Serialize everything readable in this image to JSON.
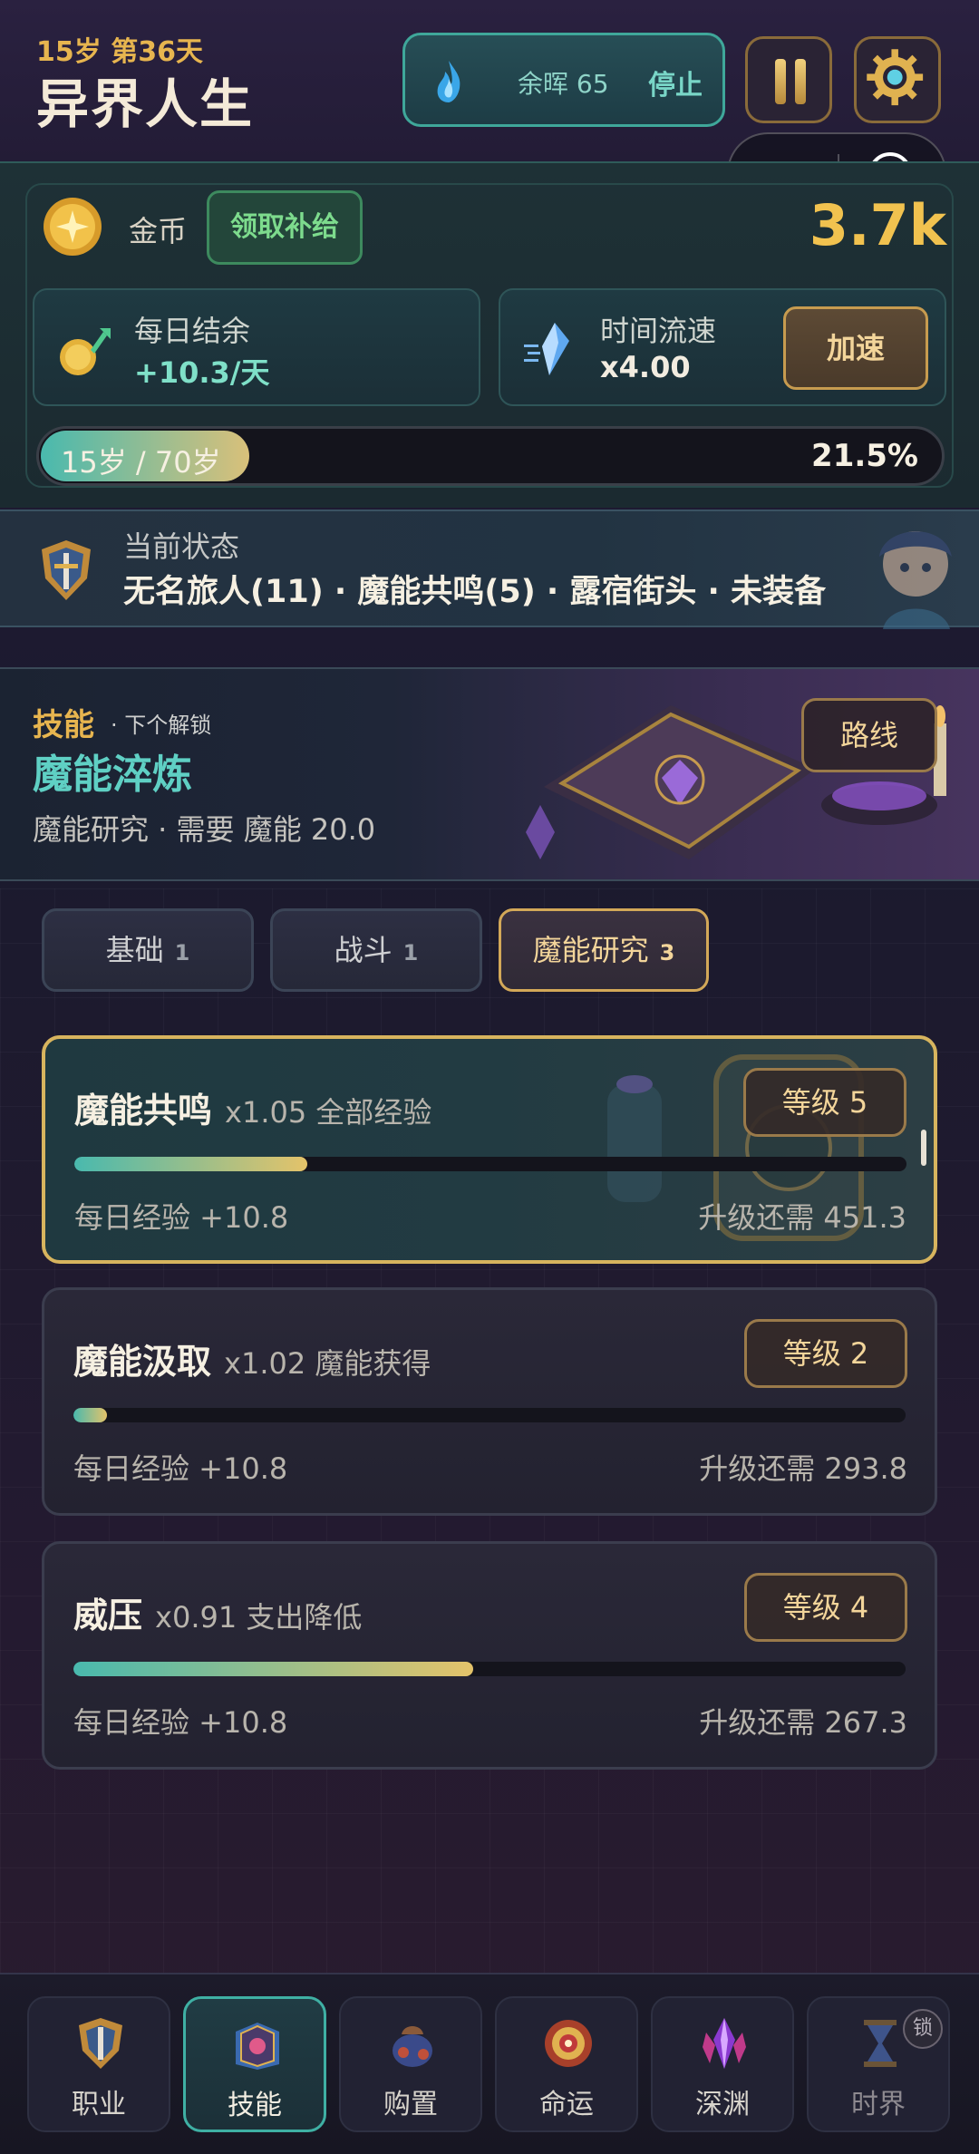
{
  "header": {
    "age_day": "15岁 第36天",
    "title": "异界人生",
    "ember": {
      "label": "余晖 65",
      "stop_label": "停止"
    }
  },
  "resources": {
    "coin_label": "金币",
    "subsidy_label": "领取补给",
    "gold_amount": "3.7k",
    "daily_balance": {
      "label": "每日结余",
      "value": "+10.3/天"
    },
    "time_speed": {
      "label": "时间流速",
      "value": "x4.00",
      "button": "加速"
    },
    "life": {
      "label": "15岁 / 70岁",
      "percent_text": "21.5%",
      "progress": 0.215
    }
  },
  "status": {
    "title": "当前状态",
    "text": "无名旅人(11) · 魔能共鸣(5) · 露宿街头 · 未装备"
  },
  "skills_banner": {
    "tag": "技能",
    "next_unlock_label": "· 下个解锁",
    "next_skill": "魔能淬炼",
    "requirement": "魔能研究 · 需要 魔能 20.0",
    "route_button": "路线"
  },
  "tabs": [
    {
      "label": "基础",
      "count": "1",
      "active": false
    },
    {
      "label": "战斗",
      "count": "1",
      "active": false
    },
    {
      "label": "魔能研究",
      "count": "3",
      "active": true
    }
  ],
  "skills": [
    {
      "name": "魔能共鸣",
      "effect": "x1.05 全部经验",
      "level": "等级 5",
      "progress": 0.28,
      "daily": "每日经验 +10.8",
      "need": "升级还需 451.3",
      "selected": true
    },
    {
      "name": "魔能汲取",
      "effect": "x1.02 魔能获得",
      "level": "等级 2",
      "progress": 0.04,
      "daily": "每日经验 +10.8",
      "need": "升级还需 293.8",
      "selected": false
    },
    {
      "name": "威压",
      "effect": "x0.91 支出降低",
      "level": "等级 4",
      "progress": 0.48,
      "daily": "每日经验 +10.8",
      "need": "升级还需 267.3",
      "selected": false
    }
  ],
  "nav": [
    {
      "label": "职业",
      "icon": "shield-icon",
      "active": false,
      "locked": false
    },
    {
      "label": "技能",
      "icon": "spellbook-icon",
      "active": true,
      "locked": false
    },
    {
      "label": "购置",
      "icon": "bag-icon",
      "active": false,
      "locked": false
    },
    {
      "label": "命运",
      "icon": "fate-wheel-icon",
      "active": false,
      "locked": false
    },
    {
      "label": "深渊",
      "icon": "abyss-crystal-icon",
      "active": false,
      "locked": false
    },
    {
      "label": "时界",
      "icon": "hourglass-icon",
      "active": false,
      "locked": true,
      "lock_label": "锁"
    }
  ],
  "colors": {
    "gold": "#e7b54f",
    "teal": "#5fd0c4",
    "card_selected_border": "#d7b45e"
  }
}
